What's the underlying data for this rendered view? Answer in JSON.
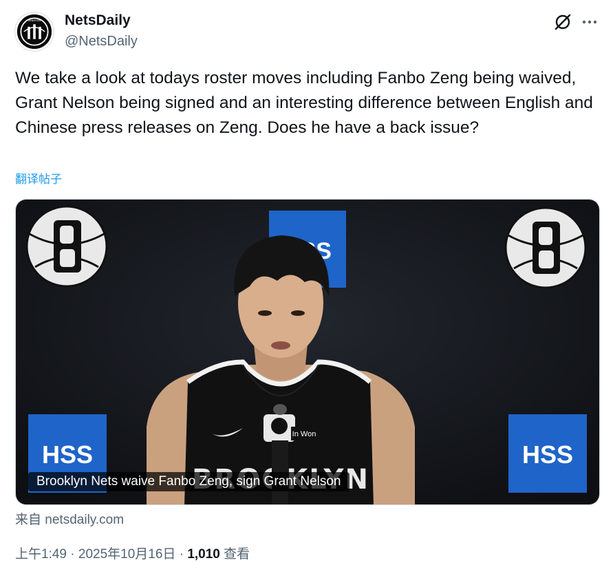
{
  "author": {
    "display_name": "NetsDaily",
    "handle": "@NetsDaily",
    "avatar_text": "SBNATION"
  },
  "icons": {
    "grok": "grok-icon",
    "more": "more-icon"
  },
  "tweet": {
    "text": "We take a look at todays roster moves including Fanbo Zeng being waived, Grant Nelson being signed and an interesting difference between English and Chinese press releases on Zeng. Does he have a back issue?",
    "translate_label": "翻译帖子"
  },
  "card": {
    "caption": "Brooklyn Nets waive Fanbo Zeng, sign Grant Nelson",
    "backdrop_logo_text": "HSS",
    "mic_text": "In Won",
    "jersey_text": "BROOKLYN"
  },
  "source": {
    "prefix": "来自",
    "domain": "netsdaily.com"
  },
  "meta": {
    "time": "上午1:49",
    "date": "2025年10月16日",
    "separator": "·",
    "views_count": "1,010",
    "views_label": "查看"
  },
  "colors": {
    "link": "#1d9bf0",
    "secondary_text": "#536471",
    "hss_blue": "#1f64c8"
  }
}
